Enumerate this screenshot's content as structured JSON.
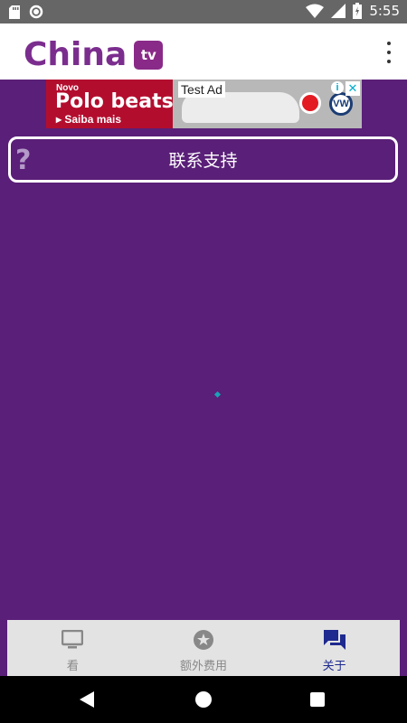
{
  "statusbar": {
    "time": "5:55",
    "icons": [
      "sd-card-icon",
      "circle-icon",
      "wifi-icon",
      "signal-icon",
      "battery-icon"
    ]
  },
  "appbar": {
    "logo_text": "China",
    "logo_badge": "tv",
    "menu_icon": "overflow-menu-icon"
  },
  "ad": {
    "label": "Test Ad",
    "kicker": "Novo",
    "headline": "Polo beats",
    "cta": "Saiba mais",
    "info": "i",
    "close": "✕",
    "vw": "VW"
  },
  "support": {
    "label": "联系支持",
    "icon": "?"
  },
  "bottom_nav": {
    "items": [
      {
        "label": "看",
        "icon": "tv-icon",
        "active": false
      },
      {
        "label": "额外费用",
        "icon": "star-icon",
        "active": false
      },
      {
        "label": "关于",
        "icon": "chat-icon",
        "active": true
      }
    ]
  },
  "colors": {
    "background": "#5a1f78",
    "accent": "#7b2d8e",
    "active_nav": "#1e2a8f"
  }
}
